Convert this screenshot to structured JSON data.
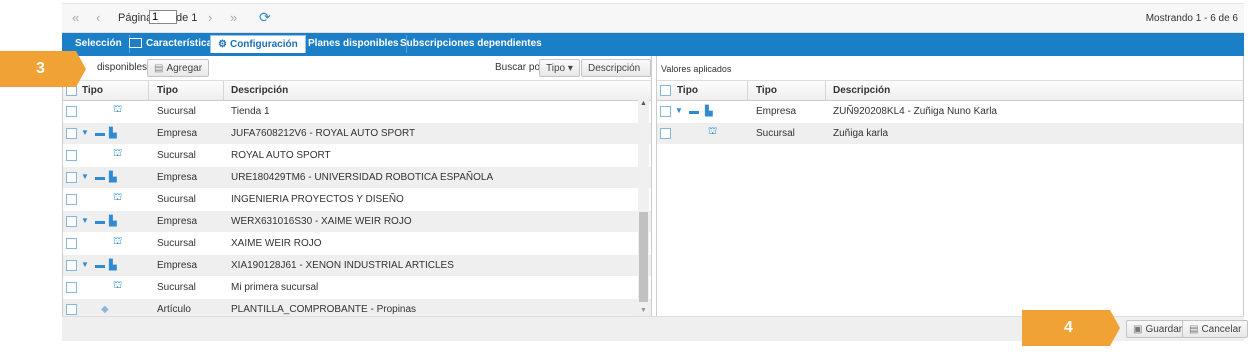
{
  "pager": {
    "first_icon": "«",
    "prev_icon": "‹",
    "page_label": "Página",
    "page_value": "1",
    "of_label": "de 1",
    "next_icon": "›",
    "last_icon": "»",
    "refresh_icon": "⟳",
    "showing": "Mostrando 1 - 6 de 6"
  },
  "tabs": {
    "seleccion": "Selección",
    "caracteristicas": "Características",
    "configuracion": "Configuración",
    "planes": "Planes disponibles",
    "suscripciones": "Subscripciones dependientes"
  },
  "left": {
    "title": "disponibles",
    "add_button": "Agregar",
    "search_label": "Buscar por:",
    "search_tipo": "Tipo",
    "search_desc": "Descripción",
    "headers": {
      "tipo_icon": "Tipo",
      "tipo": "Tipo",
      "descripcion": "Descripción"
    },
    "rows": [
      {
        "tipo": "Sucursal",
        "descripcion": "Tienda 1"
      },
      {
        "tipo": "Empresa",
        "descripcion": "JUFA7608212V6 - ROYAL AUTO SPORT"
      },
      {
        "tipo": "Sucursal",
        "descripcion": "ROYAL AUTO SPORT"
      },
      {
        "tipo": "Empresa",
        "descripcion": "URE180429TM6 - UNIVERSIDAD ROBOTICA ESPAÑOLA"
      },
      {
        "tipo": "Sucursal",
        "descripcion": "INGENIERIA PROYECTOS Y DISEÑO"
      },
      {
        "tipo": "Empresa",
        "descripcion": "WERX631016S30 - XAIME WEIR ROJO"
      },
      {
        "tipo": "Sucursal",
        "descripcion": "XAIME WEIR ROJO"
      },
      {
        "tipo": "Empresa",
        "descripcion": "XIA190128J61 - XENON INDUSTRIAL ARTICLES"
      },
      {
        "tipo": "Sucursal",
        "descripcion": "Mi primera sucursal"
      },
      {
        "tipo": "Artículo",
        "descripcion": "PLANTILLA_COMPROBANTE - Propinas"
      }
    ]
  },
  "right": {
    "title": "Valores aplicados",
    "headers": {
      "tipo_icon": "Tipo",
      "tipo": "Tipo",
      "descripcion": "Descripción"
    },
    "rows": [
      {
        "tipo": "Empresa",
        "descripcion": "ZUÑ920208KL4 - Zuñiga Nuno Karla"
      },
      {
        "tipo": "Sucursal",
        "descripcion": "Zuñiga karla"
      }
    ]
  },
  "footer": {
    "save": "Guardar",
    "cancel": "Cancelar"
  },
  "badges": {
    "step3": "3",
    "step4": "4"
  },
  "colors": {
    "accent": "#1b7fc7",
    "badge": "#f0a334"
  }
}
